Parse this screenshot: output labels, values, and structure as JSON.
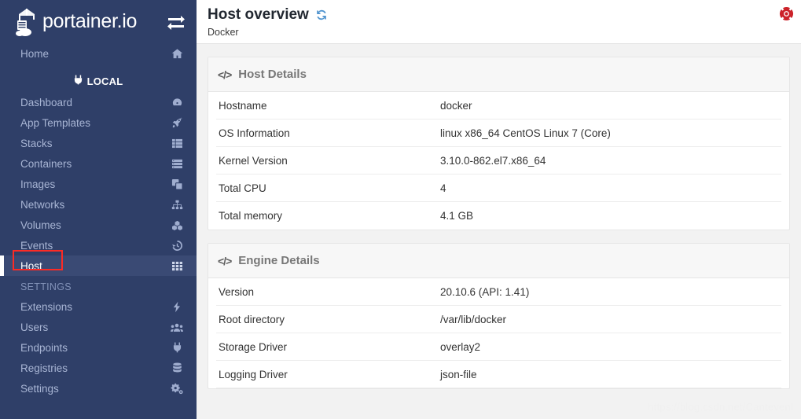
{
  "sidebar": {
    "brand": {
      "name": "portainer.io",
      "logo_icon": "portainer-logo-icon",
      "toggle_icon": "exchange-arrows-icon"
    },
    "home": {
      "label": "Home",
      "icon": "home-icon"
    },
    "local": {
      "label": "LOCAL",
      "icon": "plug-icon"
    },
    "nav_items": [
      {
        "label": "Dashboard",
        "icon": "tachometer-icon"
      },
      {
        "label": "App Templates",
        "icon": "rocket-icon"
      },
      {
        "label": "Stacks",
        "icon": "th-list-icon"
      },
      {
        "label": "Containers",
        "icon": "server-icon"
      },
      {
        "label": "Images",
        "icon": "clone-icon"
      },
      {
        "label": "Networks",
        "icon": "sitemap-icon"
      },
      {
        "label": "Volumes",
        "icon": "cubes-icon"
      },
      {
        "label": "Events",
        "icon": "history-icon"
      },
      {
        "label": "Host",
        "icon": "th-grid-icon"
      }
    ],
    "settings_title": "SETTINGS",
    "settings_items": [
      {
        "label": "Extensions",
        "icon": "bolt-icon"
      },
      {
        "label": "Users",
        "icon": "users-icon"
      },
      {
        "label": "Endpoints",
        "icon": "plug-icon"
      },
      {
        "label": "Registries",
        "icon": "database-icon"
      },
      {
        "label": "Settings",
        "icon": "gears-icon"
      }
    ]
  },
  "header": {
    "title": "Host overview",
    "subtitle": "Docker",
    "refresh_icon": "refresh-icon",
    "support_icon": "life-ring-icon"
  },
  "host_details": {
    "panel_title": "Host Details",
    "panel_icon": "code-icon",
    "rows": [
      {
        "key": "Hostname",
        "value": "docker"
      },
      {
        "key": "OS Information",
        "value": "linux x86_64 CentOS Linux 7 (Core)"
      },
      {
        "key": "Kernel Version",
        "value": "3.10.0-862.el7.x86_64"
      },
      {
        "key": "Total CPU",
        "value": "4"
      },
      {
        "key": "Total memory",
        "value": "4.1 GB"
      }
    ]
  },
  "engine_details": {
    "panel_title": "Engine Details",
    "panel_icon": "code-icon",
    "rows": [
      {
        "key": "Version",
        "value": "20.10.6 (API: 1.41)"
      },
      {
        "key": "Root directory",
        "value": "/var/lib/docker"
      },
      {
        "key": "Storage Driver",
        "value": "overlay2"
      },
      {
        "key": "Logging Driver",
        "value": "json-file"
      }
    ]
  },
  "watermark": "https://blog.csdn.net/Cantevenl",
  "colors": {
    "sidebar_bg": "#2f3f68",
    "sidebar_active": "#3a4a74",
    "sidebar_text": "#a8b5d4",
    "accent_red": "#fc2b25",
    "link_blue": "#337ab7",
    "content_bg": "#f2f2f2"
  }
}
